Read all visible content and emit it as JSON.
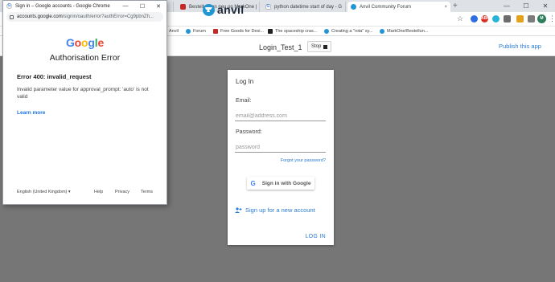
{
  "browser": {
    "tabs": [
      {
        "label": "Bestellungen neu on MarkOne |",
        "color": "#c62828"
      },
      {
        "label": "python datetime start of day - G",
        "color": "#ffffff"
      },
      {
        "label": "Anvil Community Forum",
        "color": "#2196d3"
      }
    ],
    "new_tab_label": "+",
    "bookmarks": [
      {
        "label": "Anvil",
        "color": "#2196d3"
      },
      {
        "label": "Forum",
        "color": "#2196d3"
      },
      {
        "label": "Free Goods for Desi...",
        "color": "#c62828"
      },
      {
        "label": "The spaceship cras...",
        "color": "#222222"
      },
      {
        "label": "Creating a \"rota\" sy...",
        "color": "#2196d3"
      },
      {
        "label": "MarkOne/Bestellun...",
        "color": "#2196d3"
      }
    ],
    "extensions": [
      {
        "letter": "",
        "color": "#2d6fe0"
      },
      {
        "letter": "ABP",
        "color": "#d93025"
      },
      {
        "letter": "",
        "color": "#28b3d8"
      },
      {
        "letter": "",
        "color": "#6c6c6c"
      },
      {
        "letter": "",
        "color": "#e3a21a"
      },
      {
        "letter": "",
        "color": "#7c7c7c"
      },
      {
        "letter": "M",
        "color": "#2e7d5b"
      }
    ],
    "profile_initial": "M"
  },
  "app": {
    "logo_text": "anvil",
    "title": "Login_Test_1",
    "stop_label": "Stop",
    "publish_label": "Publish this app",
    "accent": "#2a7bd4"
  },
  "login": {
    "title": "Log In",
    "email_label": "Email:",
    "email_placeholder": "email@address.com",
    "password_label": "Password:",
    "password_placeholder": "password",
    "forgot": "Forgot your password?",
    "google_button": "Sign in with Google",
    "signup": "Sign up for a new account",
    "login_link": "LOG IN"
  },
  "popup": {
    "window_title": "Sign in – Google accounts - Google Chrome",
    "url_host": "accounts.google.com",
    "url_path": "/signin/oauth/error?authError=Cg9pbnZh...",
    "logo_text": "Google",
    "heading": "Authorisation Error",
    "error_code": "Error 400: invalid_request",
    "error_message": "Invalid parameter value for approval_prompt: 'auto' is not valid",
    "learn_more": "Learn more",
    "language": "English (United Kingdom)",
    "footer_links": [
      "Help",
      "Privacy",
      "Terms"
    ]
  }
}
